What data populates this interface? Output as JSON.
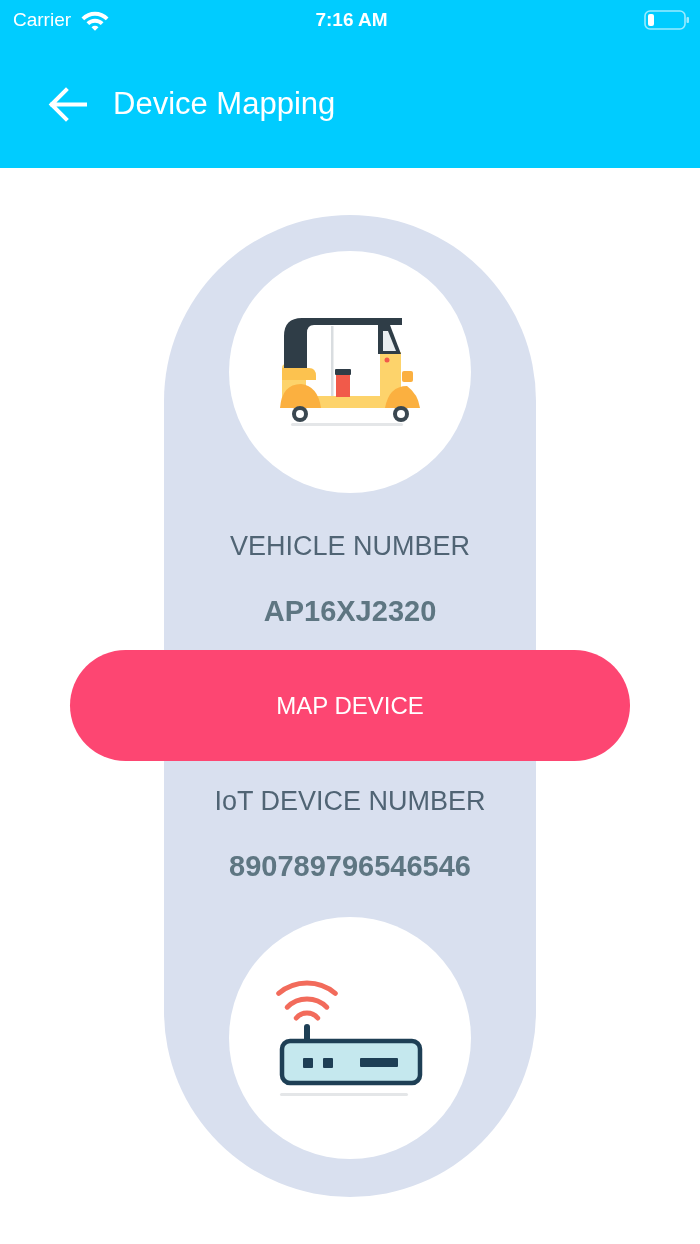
{
  "status_bar": {
    "carrier": "Carrier",
    "time": "7:16 AM"
  },
  "header": {
    "title": "Device Mapping"
  },
  "vehicle": {
    "label": "VEHICLE NUMBER",
    "value": "AP16XJ2320"
  },
  "action": {
    "label": "MAP DEVICE"
  },
  "device": {
    "label": "IoT DEVICE NUMBER",
    "value": "890789796546546"
  }
}
